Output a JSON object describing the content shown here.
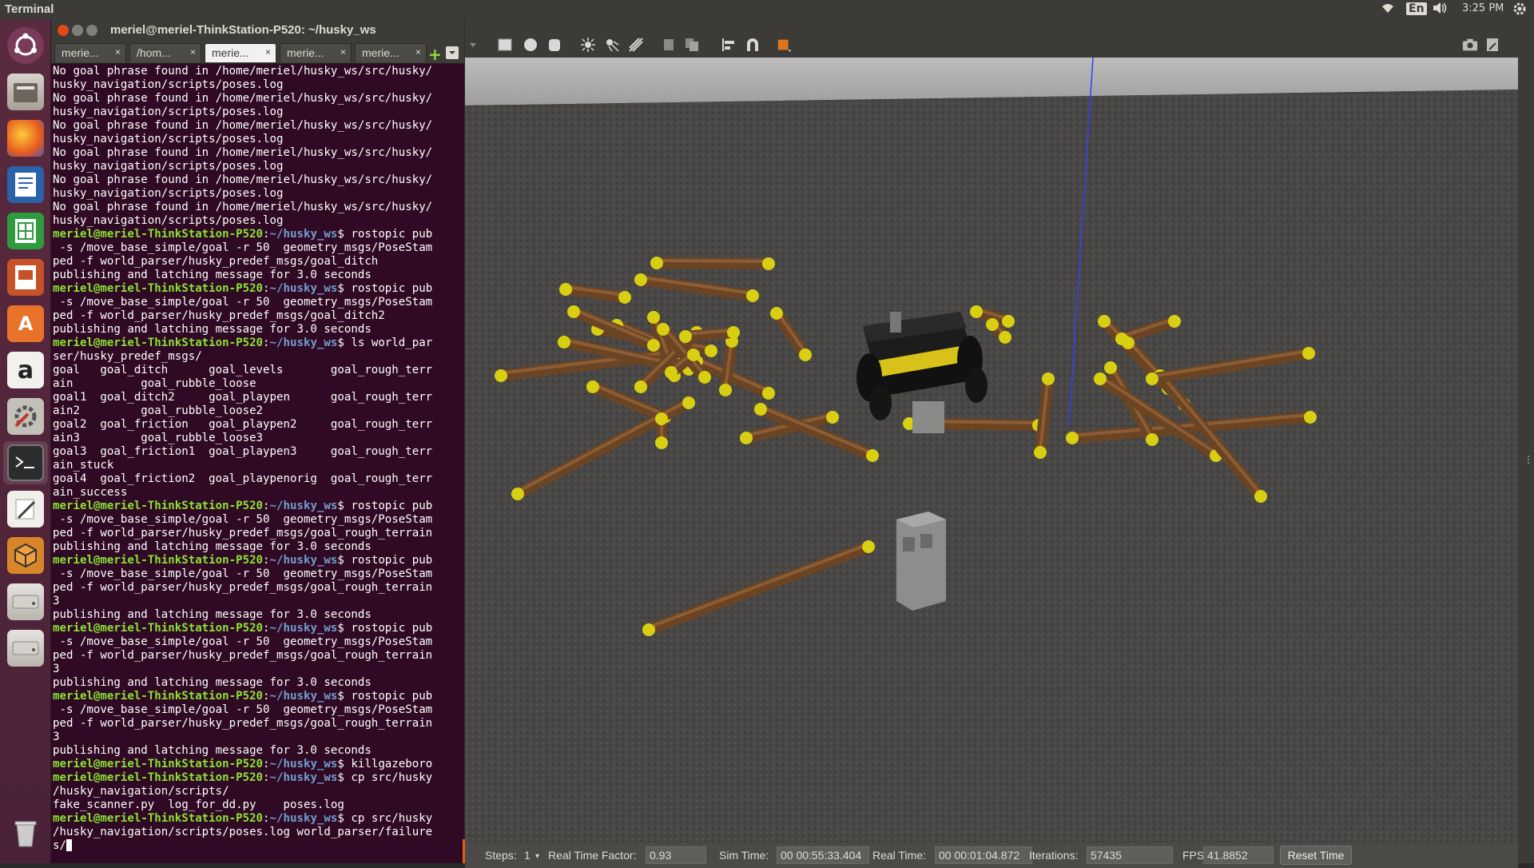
{
  "topbar": {
    "app_name": "Terminal",
    "lang": "En",
    "time": "3:25 PM"
  },
  "launcher": {
    "items": [
      "ubuntu-dash-icon",
      "files-icon",
      "firefox-icon",
      "writer-icon",
      "calc-icon",
      "impress-icon",
      "software-center-icon",
      "amazon-icon",
      "system-settings-icon",
      "terminal-icon",
      "text-editor-icon",
      "virtualbox-icon",
      "drive-icon",
      "drive-icon",
      "trash-icon"
    ]
  },
  "terminal": {
    "title": "meriel@meriel-ThinkStation-P520: ~/husky_ws",
    "tabs": [
      "merie...",
      "/hom...",
      "merie...",
      "merie...",
      "merie..."
    ],
    "active_tab": 2,
    "lines": [
      [
        {
          "t": "No goal phrase found in /home/meriel/husky_ws/src/husky/",
          "c": ""
        }
      ],
      [
        {
          "t": "husky_navigation/scripts/poses.log",
          "c": ""
        }
      ],
      [
        {
          "t": "No goal phrase found in /home/meriel/husky_ws/src/husky/",
          "c": ""
        }
      ],
      [
        {
          "t": "husky_navigation/scripts/poses.log",
          "c": ""
        }
      ],
      [
        {
          "t": "No goal phrase found in /home/meriel/husky_ws/src/husky/",
          "c": ""
        }
      ],
      [
        {
          "t": "husky_navigation/scripts/poses.log",
          "c": ""
        }
      ],
      [
        {
          "t": "No goal phrase found in /home/meriel/husky_ws/src/husky/",
          "c": ""
        }
      ],
      [
        {
          "t": "husky_navigation/scripts/poses.log",
          "c": ""
        }
      ],
      [
        {
          "t": "No goal phrase found in /home/meriel/husky_ws/src/husky/",
          "c": ""
        }
      ],
      [
        {
          "t": "husky_navigation/scripts/poses.log",
          "c": ""
        }
      ],
      [
        {
          "t": "No goal phrase found in /home/meriel/husky_ws/src/husky/",
          "c": ""
        }
      ],
      [
        {
          "t": "husky_navigation/scripts/poses.log",
          "c": ""
        }
      ],
      [
        {
          "t": "meriel@meriel-ThinkStation-P520",
          "c": "pu"
        },
        {
          "t": ":",
          "c": ""
        },
        {
          "t": "~/husky_ws",
          "c": "pp"
        },
        {
          "t": "$ rostopic pub",
          "c": ""
        }
      ],
      [
        {
          "t": " -s /move_base_simple/goal -r 50  geometry_msgs/PoseStam",
          "c": ""
        }
      ],
      [
        {
          "t": "ped -f world_parser/husky_predef_msgs/goal_ditch",
          "c": ""
        }
      ],
      [
        {
          "t": "publishing and latching message for 3.0 seconds",
          "c": ""
        }
      ],
      [
        {
          "t": "meriel@meriel-ThinkStation-P520",
          "c": "pu"
        },
        {
          "t": ":",
          "c": ""
        },
        {
          "t": "~/husky_ws",
          "c": "pp"
        },
        {
          "t": "$ rostopic pub",
          "c": ""
        }
      ],
      [
        {
          "t": " -s /move_base_simple/goal -r 50  geometry_msgs/PoseStam",
          "c": ""
        }
      ],
      [
        {
          "t": "ped -f world_parser/husky_predef_msgs/goal_ditch2",
          "c": ""
        }
      ],
      [
        {
          "t": "publishing and latching message for 3.0 seconds",
          "c": ""
        }
      ],
      [
        {
          "t": "meriel@meriel-ThinkStation-P520",
          "c": "pu"
        },
        {
          "t": ":",
          "c": ""
        },
        {
          "t": "~/husky_ws",
          "c": "pp"
        },
        {
          "t": "$ ls world_par",
          "c": ""
        }
      ],
      [
        {
          "t": "ser/husky_predef_msgs/",
          "c": ""
        }
      ],
      [
        {
          "t": "goal   goal_ditch      goal_levels       goal_rough_terr",
          "c": ""
        }
      ],
      [
        {
          "t": "ain          goal_rubble_loose",
          "c": ""
        }
      ],
      [
        {
          "t": "goal1  goal_ditch2     goal_playpen      goal_rough_terr",
          "c": ""
        }
      ],
      [
        {
          "t": "ain2         goal_rubble_loose2",
          "c": ""
        }
      ],
      [
        {
          "t": "goal2  goal_friction   goal_playpen2     goal_rough_terr",
          "c": ""
        }
      ],
      [
        {
          "t": "ain3         goal_rubble_loose3",
          "c": ""
        }
      ],
      [
        {
          "t": "goal3  goal_friction1  goal_playpen3     goal_rough_terr",
          "c": ""
        }
      ],
      [
        {
          "t": "ain_stuck",
          "c": ""
        }
      ],
      [
        {
          "t": "goal4  goal_friction2  goal_playpenorig  goal_rough_terr",
          "c": ""
        }
      ],
      [
        {
          "t": "ain_success",
          "c": ""
        }
      ],
      [
        {
          "t": "meriel@meriel-ThinkStation-P520",
          "c": "pu"
        },
        {
          "t": ":",
          "c": ""
        },
        {
          "t": "~/husky_ws",
          "c": "pp"
        },
        {
          "t": "$ rostopic pub",
          "c": ""
        }
      ],
      [
        {
          "t": " -s /move_base_simple/goal -r 50  geometry_msgs/PoseStam",
          "c": ""
        }
      ],
      [
        {
          "t": "ped -f world_parser/husky_predef_msgs/goal_rough_terrain",
          "c": ""
        }
      ],
      [
        {
          "t": "publishing and latching message for 3.0 seconds",
          "c": ""
        }
      ],
      [
        {
          "t": "meriel@meriel-ThinkStation-P520",
          "c": "pu"
        },
        {
          "t": ":",
          "c": ""
        },
        {
          "t": "~/husky_ws",
          "c": "pp"
        },
        {
          "t": "$ rostopic pub",
          "c": ""
        }
      ],
      [
        {
          "t": " -s /move_base_simple/goal -r 50  geometry_msgs/PoseStam",
          "c": ""
        }
      ],
      [
        {
          "t": "ped -f world_parser/husky_predef_msgs/goal_rough_terrain",
          "c": ""
        }
      ],
      [
        {
          "t": "3",
          "c": ""
        }
      ],
      [
        {
          "t": "publishing and latching message for 3.0 seconds",
          "c": ""
        }
      ],
      [
        {
          "t": "meriel@meriel-ThinkStation-P520",
          "c": "pu"
        },
        {
          "t": ":",
          "c": ""
        },
        {
          "t": "~/husky_ws",
          "c": "pp"
        },
        {
          "t": "$ rostopic pub",
          "c": ""
        }
      ],
      [
        {
          "t": " -s /move_base_simple/goal -r 50  geometry_msgs/PoseStam",
          "c": ""
        }
      ],
      [
        {
          "t": "ped -f world_parser/husky_predef_msgs/goal_rough_terrain",
          "c": ""
        }
      ],
      [
        {
          "t": "3",
          "c": ""
        }
      ],
      [
        {
          "t": "publishing and latching message for 3.0 seconds",
          "c": ""
        }
      ],
      [
        {
          "t": "meriel@meriel-ThinkStation-P520",
          "c": "pu"
        },
        {
          "t": ":",
          "c": ""
        },
        {
          "t": "~/husky_ws",
          "c": "pp"
        },
        {
          "t": "$ rostopic pub",
          "c": ""
        }
      ],
      [
        {
          "t": " -s /move_base_simple/goal -r 50  geometry_msgs/PoseStam",
          "c": ""
        }
      ],
      [
        {
          "t": "ped -f world_parser/husky_predef_msgs/goal_rough_terrain",
          "c": ""
        }
      ],
      [
        {
          "t": "3",
          "c": ""
        }
      ],
      [
        {
          "t": "publishing and latching message for 3.0 seconds",
          "c": ""
        }
      ],
      [
        {
          "t": "meriel@meriel-ThinkStation-P520",
          "c": "pu"
        },
        {
          "t": ":",
          "c": ""
        },
        {
          "t": "~/husky_ws",
          "c": "pp"
        },
        {
          "t": "$ killgazeboro",
          "c": ""
        }
      ],
      [
        {
          "t": "meriel@meriel-ThinkStation-P520",
          "c": "pu"
        },
        {
          "t": ":",
          "c": ""
        },
        {
          "t": "~/husky_ws",
          "c": "pp"
        },
        {
          "t": "$ cp src/husky",
          "c": ""
        }
      ],
      [
        {
          "t": "/husky_navigation/scripts/",
          "c": ""
        }
      ],
      [
        {
          "t": "fake_scanner.py  log_for_dd.py    poses.log",
          "c": ""
        }
      ],
      [
        {
          "t": "meriel@meriel-ThinkStation-P520",
          "c": "pu"
        },
        {
          "t": ":",
          "c": ""
        },
        {
          "t": "~/husky_ws",
          "c": "pp"
        },
        {
          "t": "$ cp src/husky",
          "c": ""
        }
      ],
      [
        {
          "t": "/husky_navigation/scripts/poses.log world_parser/failure",
          "c": ""
        }
      ],
      [
        {
          "t": "s/",
          "c": ""
        }
      ]
    ]
  },
  "gazebo": {
    "statusbar": {
      "steps_label": "Steps:",
      "steps_value": "1",
      "rtf_label": "Real Time Factor:",
      "rtf_value": "0.93",
      "sim_label": "Sim Time:",
      "sim_value": "00 00:55:33.404",
      "real_label": "Real Time:",
      "real_value": "00 00:01:04.872",
      "iter_label": "Iterations:",
      "iter_value": "57435",
      "fps_label": "FPS:",
      "fps_value": "41.8852",
      "reset_label": "Reset Time"
    }
  }
}
